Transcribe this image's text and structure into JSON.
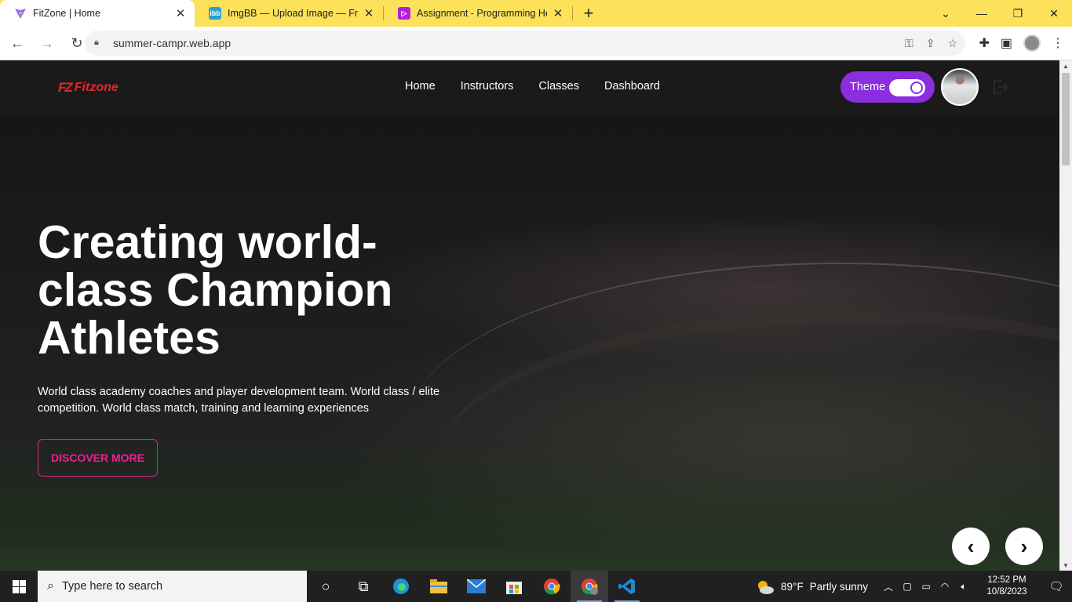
{
  "browser": {
    "tabs": [
      {
        "title": "FitZone | Home",
        "active": true,
        "favicon": "vite-icon"
      },
      {
        "title": "ImgBB — Upload Image — Free",
        "active": false,
        "favicon": "imgbb-icon"
      },
      {
        "title": "Assignment - Programming Her",
        "active": false,
        "favicon": "programming-hero-icon"
      }
    ],
    "new_tab": "+",
    "url": "summer-campr.web.app",
    "accent": "#fce15a"
  },
  "site": {
    "logo_mark": "FZ",
    "logo_text": "Fitzone",
    "nav": [
      "Home",
      "Instructors",
      "Classes",
      "Dashboard"
    ],
    "theme_label": "Theme",
    "theme_on": true,
    "accent": "#8c2de0",
    "cta_color": "#f01f93"
  },
  "hero": {
    "title": "Creating world-class Champion Athletes",
    "description": "World class academy coaches and player development team. World class / elite competition. World class match, training and learning experiences",
    "cta": "DISCOVER MORE",
    "prev": "‹",
    "next": "›"
  },
  "taskbar": {
    "search_placeholder": "Type here to search",
    "weather_temp": "89°F",
    "weather_text": "Partly sunny",
    "time": "12:52 PM",
    "date": "10/8/2023"
  }
}
